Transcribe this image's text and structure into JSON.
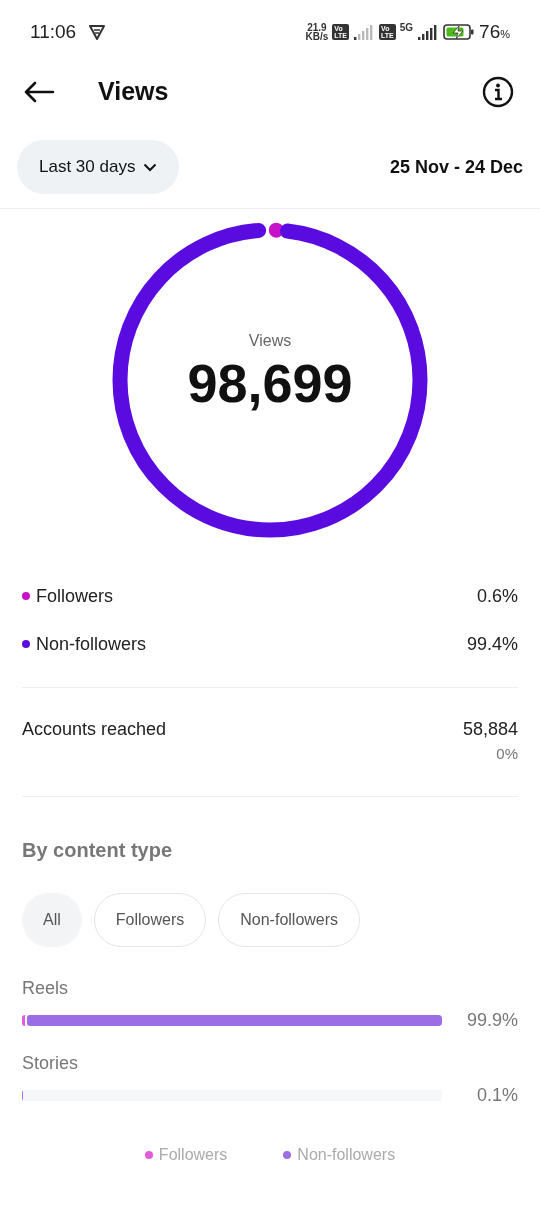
{
  "status_bar": {
    "time": "11:06",
    "speed_value": "21.9",
    "speed_unit": "KB/s",
    "volte": [
      {
        "top": "Vo",
        "bottom": "LTE"
      },
      {
        "top": "Vo",
        "bottom": "LTE"
      }
    ],
    "network": "5G",
    "battery": "76",
    "battery_unit": "%"
  },
  "header": {
    "title": "Views"
  },
  "filter": {
    "period": "Last 30 days",
    "date_range": "25 Nov - 24 Dec"
  },
  "summary": {
    "label": "Views",
    "total": "98,699"
  },
  "breakdown": [
    {
      "label": "Followers",
      "value": "0.6%",
      "color": "#c612c9"
    },
    {
      "label": "Non-followers",
      "value": "99.4%",
      "color": "#5a0bdf"
    }
  ],
  "accounts_reached": {
    "label": "Accounts reached",
    "value": "58,884",
    "change": "0%"
  },
  "content_type": {
    "title": "By content type",
    "chips": [
      {
        "label": "All",
        "selected": true
      },
      {
        "label": "Followers",
        "selected": false
      },
      {
        "label": "Non-followers",
        "selected": false
      }
    ],
    "rows": [
      {
        "label": "Reels",
        "level": 0.999,
        "value": "99.9%"
      },
      {
        "label": "Stories",
        "level": 0.001,
        "value": "0.1%"
      }
    ],
    "legend": [
      {
        "label": "Followers",
        "color": "#e35bdc"
      },
      {
        "label": "Non-followers",
        "color": "#9c6ee6"
      }
    ]
  }
}
